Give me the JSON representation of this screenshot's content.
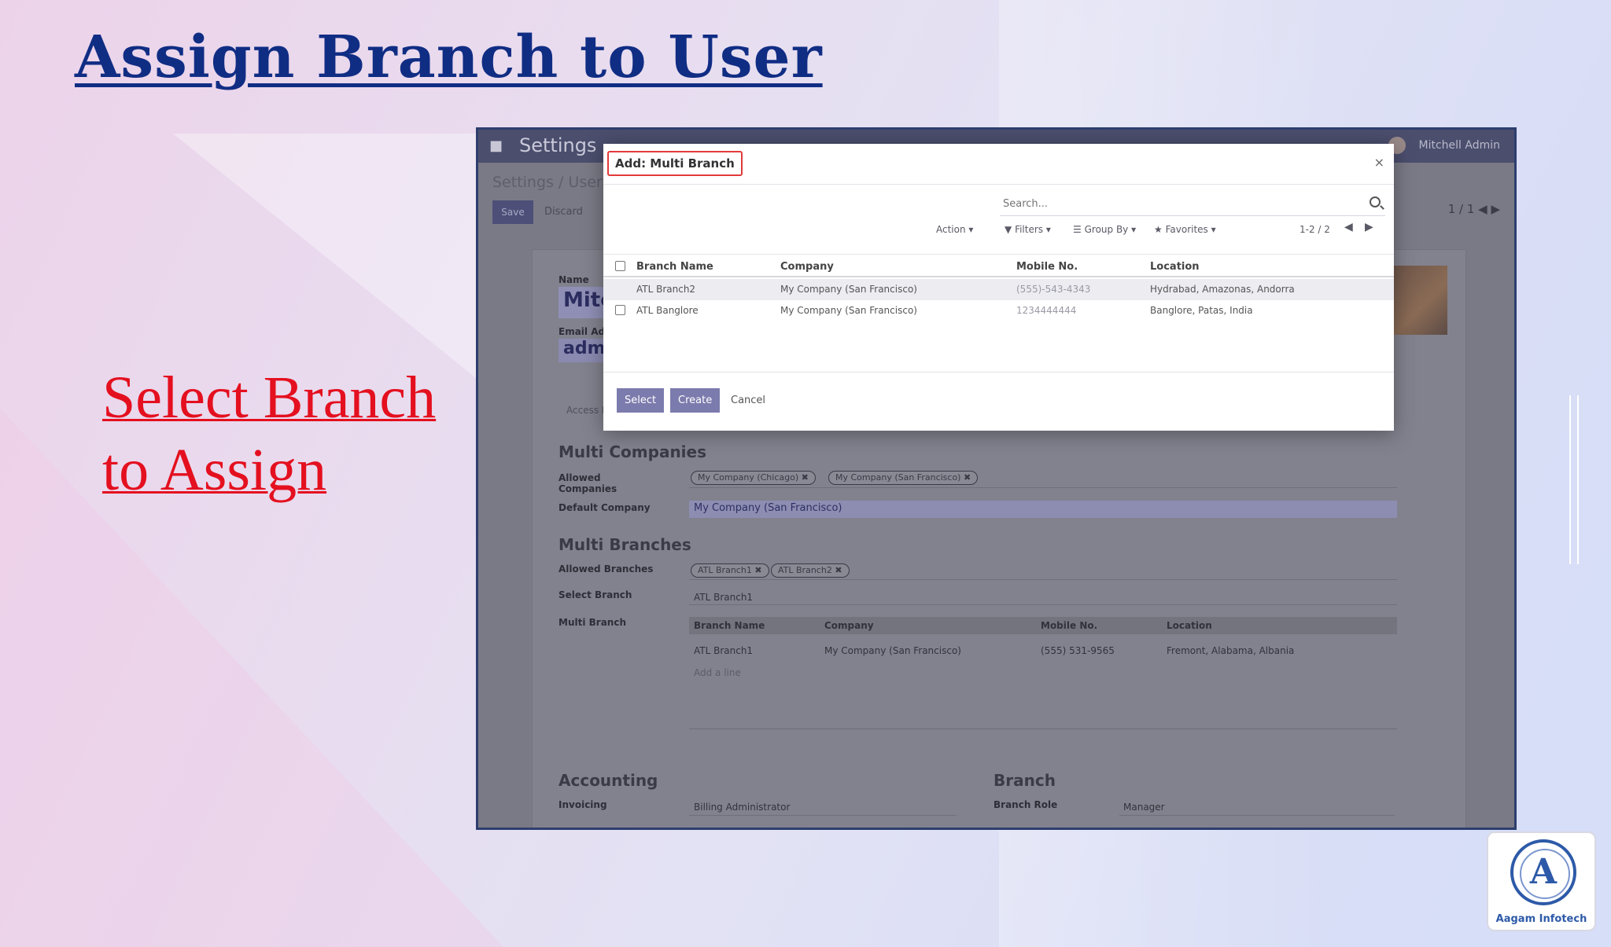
{
  "slide": {
    "title": "Assign Branch to User",
    "caption": "Select Branch to Assign"
  },
  "background_app": {
    "app_title": "Settings",
    "user_name": "Mitchell Admin",
    "breadcrumb": "Settings / Users",
    "save_label": "Save",
    "discard_label": "Discard",
    "pager": "1 / 1",
    "name_label": "Name",
    "name_value": "Mitc",
    "email_label": "Email Address",
    "email_value": "admi",
    "tab_label": "Access Rights",
    "multi_companies_title": "Multi Companies",
    "allowed_companies_label": "Allowed Companies",
    "allowed_companies": [
      "My Company (Chicago)",
      "My Company (San Francisco)"
    ],
    "default_company_label": "Default Company",
    "default_company_value": "My Company (San Francisco)",
    "multi_branches_title": "Multi Branches",
    "allowed_branches_label": "Allowed Branches",
    "allowed_branches": [
      "ATL Branch1",
      "ATL Branch2"
    ],
    "select_branch_label": "Select Branch",
    "select_branch_value": "ATL Branch1",
    "multi_branch_label": "Multi Branch",
    "multi_branch_table": {
      "headers": [
        "Branch Name",
        "Company",
        "Mobile No.",
        "Location"
      ],
      "rows": [
        [
          "ATL Branch1",
          "My Company (San Francisco)",
          "(555) 531-9565",
          "Fremont, Alabama, Albania"
        ]
      ]
    },
    "add_line": "Add a line",
    "accounting_title": "Accounting",
    "invoicing_label": "Invoicing",
    "invoicing_value": "Billing Administrator",
    "branch_title": "Branch",
    "branch_role_label": "Branch Role",
    "branch_role_value": "Manager"
  },
  "modal": {
    "title": "Add: Multi Branch",
    "close": "×",
    "search_placeholder": "Search...",
    "action_label": "Action",
    "filters_label": "Filters",
    "groupby_label": "Group By",
    "favorites_label": "Favorites",
    "pager": "1-2 / 2",
    "headers": [
      "Branch Name",
      "Company",
      "Mobile No.",
      "Location"
    ],
    "rows": [
      {
        "branch": "ATL Branch2",
        "company": "My Company (San Francisco)",
        "mobile": "(555)-543-4343",
        "location": "Hydrabad, Amazonas, Andorra"
      },
      {
        "branch": "ATL Banglore",
        "company": "My Company (San Francisco)",
        "mobile": "1234444444",
        "location": "Banglore, Patas, India"
      }
    ],
    "select_label": "Select",
    "create_label": "Create",
    "cancel_label": "Cancel"
  },
  "logo": {
    "letter": "A",
    "text": "Aagam Infotech"
  }
}
